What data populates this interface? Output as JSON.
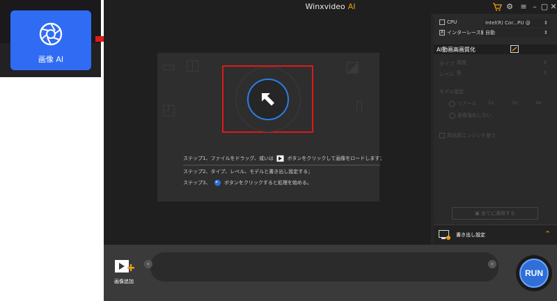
{
  "inset": {
    "tile_label": "画像 AI",
    "colors": {
      "tile": "#2f6cf3",
      "arrow": "#e01919"
    }
  },
  "titlebar": {
    "app_name": "Winxvideo",
    "app_suffix": "AI",
    "icons": [
      "cart-icon",
      "settings-icon",
      "menu-icon",
      "minimize-icon",
      "maximize-icon",
      "close-icon"
    ]
  },
  "dropzone": {
    "steps": [
      {
        "prefix": "ステップ1、ファイルをドラッグ、或いは",
        "suffix": "ボタンをクリックして画像をロードします；"
      },
      {
        "prefix": "ステップ2、タイプ、レベル、モデルと書き出し設定する；",
        "suffix": ""
      },
      {
        "prefix": "ステップ3、",
        "suffix": "ボタンをクリックすると処理を始める。"
      }
    ]
  },
  "rightpanel": {
    "cpu_label": "CPU",
    "cpu_value": "Intel(R) Cor...PU @ 3.20GHz",
    "interlace_label": "インターレース解除",
    "interlace_value": "自動",
    "section_title": "AI動画高画質化",
    "type_label": "タイプ",
    "type_value": "高度",
    "level_label": "レベル",
    "level_value": "低",
    "model_label": "モデル設定",
    "model_options": [
      "リアール",
      "2x",
      "3x",
      "4x"
    ],
    "model_option_none": "画像強化しない",
    "hw_label": "高品質エンジンを使う",
    "apply_all": "全てに適用する",
    "export_label": "書き出し設定"
  },
  "bottombar": {
    "add_image_label": "画像追加",
    "run_label": "RUN"
  }
}
